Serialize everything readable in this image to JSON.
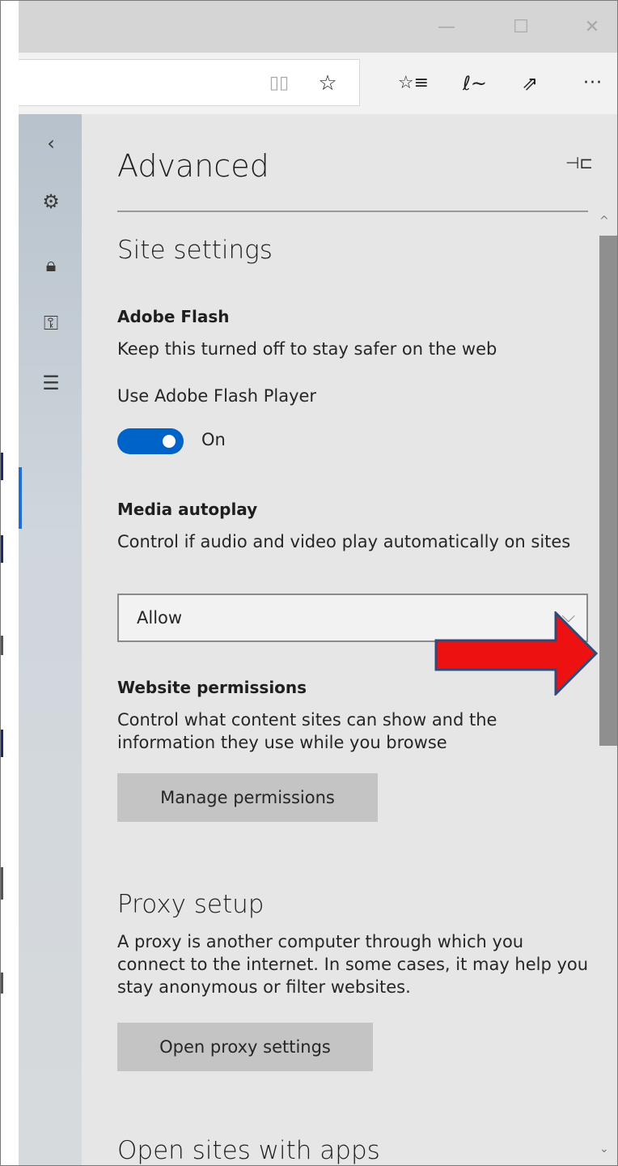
{
  "window": {
    "minimize_glyph": "—",
    "maximize_glyph": "☐",
    "close_glyph": "✕"
  },
  "toolbar": {
    "reading_view_icon": "book-icon",
    "favorite_icon": "star-icon",
    "favorites_hub_icon": "favorites-list-icon",
    "notes_icon": "pen-icon",
    "share_icon": "share-icon",
    "more_icon": "ellipsis-icon",
    "glyphs": {
      "reading": "▯▯",
      "star": "☆",
      "favbar": "☆≡",
      "pen": "ℓ~",
      "share": "⇗",
      "more": "···"
    }
  },
  "rail": {
    "items": [
      {
        "name": "back-icon",
        "glyph": "‹"
      },
      {
        "name": "gear-icon",
        "glyph": "⚙"
      },
      {
        "name": "lock-icon",
        "glyph": "🔒︎"
      },
      {
        "name": "key-icon",
        "glyph": "⚿"
      },
      {
        "name": "sliders-icon",
        "glyph": "☰"
      }
    ]
  },
  "panel": {
    "title": "Advanced",
    "pin_glyph": "⊣⊏",
    "site_settings": {
      "heading": "Site settings",
      "flash": {
        "label": "Adobe Flash",
        "description": "Keep this turned off to stay safer on the web",
        "toggle_caption": "Use Adobe Flash Player",
        "toggle_state": "On"
      },
      "autoplay": {
        "label": "Media autoplay",
        "description": "Control if audio and video play automatically on sites",
        "selected": "Allow"
      },
      "permissions": {
        "label": "Website permissions",
        "description": "Control what content sites can show and the information they use while you browse",
        "button": "Manage permissions"
      }
    },
    "proxy": {
      "heading": "Proxy setup",
      "description": "A proxy is another computer through which you connect to the internet. In some cases, it may help you stay anonymous or filter websites.",
      "button": "Open proxy settings"
    },
    "apps": {
      "heading": "Open sites with apps"
    }
  },
  "colors": {
    "accent": "#0063c7",
    "panel_bg": "#e6e6e6",
    "annotation_arrow": "#ee1111"
  }
}
